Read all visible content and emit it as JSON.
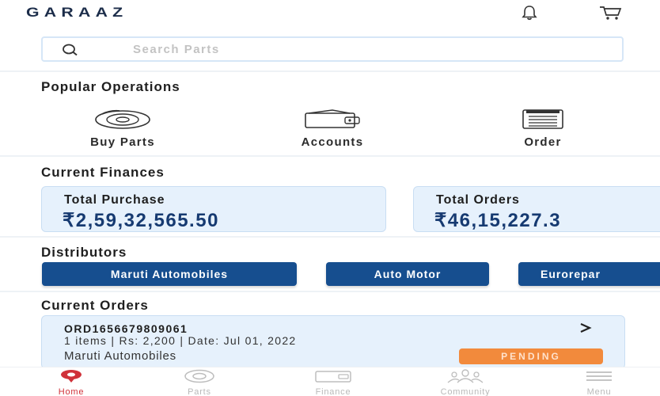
{
  "header": {
    "logo": "GARAAZ",
    "icons": [
      "bell-icon",
      "cart-icon"
    ]
  },
  "search": {
    "placeholder": "Search Parts"
  },
  "popular_operations": {
    "title": "Popular Operations",
    "items": [
      {
        "label": "Buy Parts",
        "icon": "disc-brake-icon"
      },
      {
        "label": "Accounts",
        "icon": "wallet-icon"
      },
      {
        "label": "Order",
        "icon": "order-list-icon"
      }
    ]
  },
  "current_finances": {
    "title": "Current Finances",
    "cards": [
      {
        "label": "Total Purchase",
        "value": "₹2,59,32,565.50"
      },
      {
        "label": "Total Orders",
        "value": "₹46,15,227.3"
      }
    ]
  },
  "distributors": {
    "title": "Distributors",
    "items": [
      "Maruti Automobiles",
      "Auto Motor",
      "Eurorepar"
    ]
  },
  "current_orders": {
    "title": "Current Orders",
    "orders": [
      {
        "id": "ORD1656679809061",
        "meta": "1 items | Rs: 2,200 | Date: Jul 01, 2022",
        "distributor": "Maruti Automobiles",
        "status": "PENDING"
      }
    ]
  },
  "bottom_nav": {
    "items": [
      {
        "label": "Home",
        "icon": "home-icon",
        "active": true
      },
      {
        "label": "Parts",
        "icon": "parts-icon",
        "active": false
      },
      {
        "label": "Finance",
        "icon": "finance-icon",
        "active": false
      },
      {
        "label": "Community",
        "icon": "community-icon",
        "active": false
      },
      {
        "label": "Menu",
        "icon": "menu-icon",
        "active": false
      }
    ]
  },
  "colors": {
    "brand_blue": "#164e8f",
    "card_bg": "#e6f1fc",
    "status_pending": "#f28a3c",
    "active_nav": "#d0323a"
  }
}
